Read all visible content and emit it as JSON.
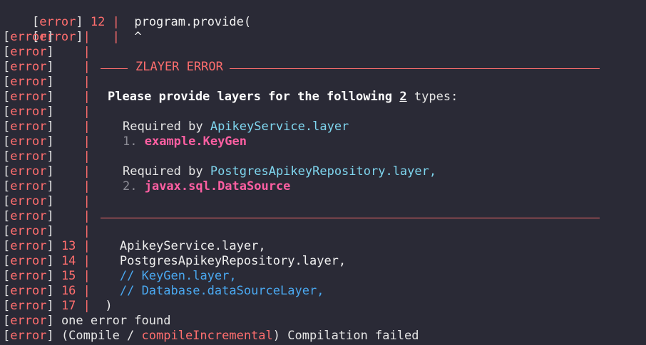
{
  "colors": {
    "background": "#2a2a36",
    "error_tag": "#ff6e6e",
    "comment": "#4aa8f0",
    "type_name": "#7fd6ef",
    "required_type": "#ff5fa2"
  },
  "tag": {
    "open": "[",
    "word": "error",
    "close": "]"
  },
  "lines": [
    {
      "num": "12",
      "sep": "|",
      "code": "  program.provide("
    },
    {
      "num": "",
      "sep": "|",
      "code": "  ^"
    },
    {
      "num": "",
      "sep": "|",
      "code": ""
    },
    {
      "num": "",
      "sep": "|",
      "code": ""
    },
    {
      "num": "",
      "sep": "|",
      "code": ""
    },
    {
      "num": "",
      "sep": "|",
      "code": ""
    },
    {
      "num": "",
      "sep": "|",
      "code": ""
    },
    {
      "num": "",
      "sep": "|",
      "code": ""
    },
    {
      "num": "",
      "sep": "|",
      "code": ""
    },
    {
      "num": "",
      "sep": "|",
      "code": ""
    },
    {
      "num": "",
      "sep": "|",
      "code": ""
    },
    {
      "num": "",
      "sep": "|",
      "code": ""
    },
    {
      "num": "",
      "sep": "|",
      "code": ""
    },
    {
      "num": "",
      "sep": "|",
      "code": ""
    },
    {
      "num": "",
      "sep": "|",
      "code": ""
    },
    {
      "num": "",
      "sep": "|",
      "code": ""
    },
    {
      "num": "13",
      "sep": "|",
      "code": "    ApikeyService.layer,"
    },
    {
      "num": "14",
      "sep": "|",
      "code": "    PostgresApikeyRepository.layer,"
    },
    {
      "num": "15",
      "sep": "|",
      "code": "    // KeyGen.layer,"
    },
    {
      "num": "16",
      "sep": "|",
      "code": "    // Database.dataSourceLayer,"
    },
    {
      "num": "17",
      "sep": "|",
      "code": "  )"
    }
  ],
  "zlayer": {
    "header": "ZLAYER ERROR",
    "message_pre": "Please provide layers for the following ",
    "message_count": "2",
    "message_post": " types:",
    "requirements": [
      {
        "required_by": "Required by ",
        "layer": "ApikeyService.layer",
        "index": "1. ",
        "type": "example.KeyGen"
      },
      {
        "required_by": "Required by ",
        "layer": "PostgresApikeyRepository.layer,",
        "index": "2. ",
        "type": "javax.sql.DataSource"
      }
    ]
  },
  "summary": {
    "found": "one error found",
    "compile_pre": "(Compile / ",
    "compile_task": "compileIncremental",
    "compile_post": ") Compilation failed"
  }
}
